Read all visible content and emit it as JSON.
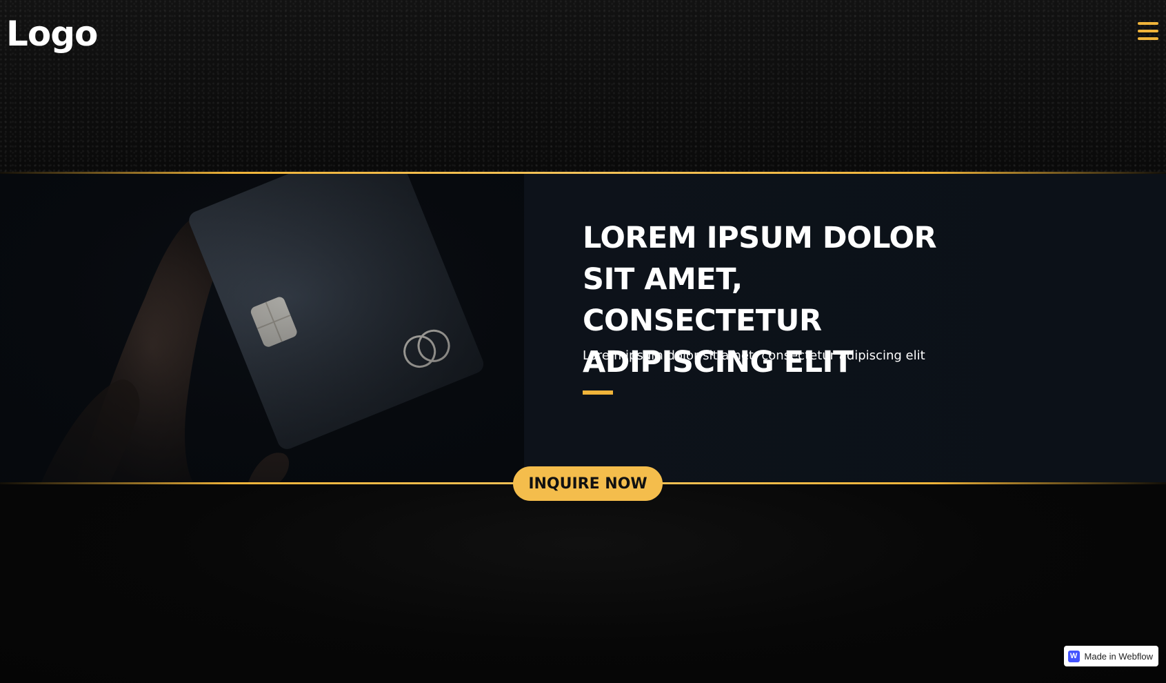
{
  "header": {
    "logo_text": "Logo",
    "menu_icon": "hamburger-menu-icon"
  },
  "hero": {
    "image_description_icon": "card-photo",
    "title": "LOREM IPSUM DOLOR SIT AMET, CONSECTETUR ADIPISCING ELIT",
    "subtitle": "Lorem ipsum dolor sit amet, consectetur adipiscing elit",
    "cta_label": "INQUIRE NOW"
  },
  "badge": {
    "icon": "webflow-icon",
    "icon_letter": "W",
    "label": "Made in Webflow"
  },
  "colors": {
    "accent": "#f0b43a",
    "button": "#f4bd4c",
    "background": "#050505"
  }
}
